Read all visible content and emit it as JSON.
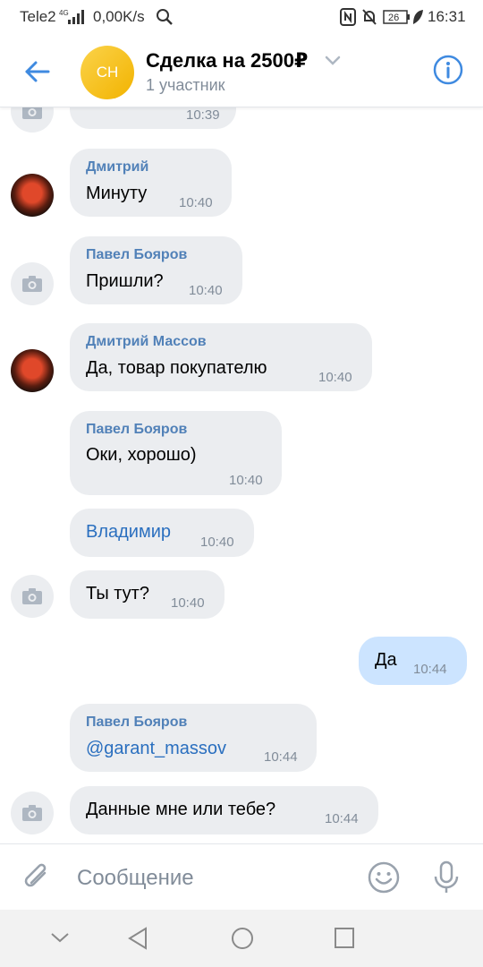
{
  "status_bar": {
    "carrier": "Tele2",
    "network": "4G",
    "speed": "0,00K/s",
    "battery": "26",
    "time": "16:31"
  },
  "header": {
    "avatar_initials": "СН",
    "title": "Сделка на 2500₽",
    "subtitle": "1 участник",
    "avatar_color": "#f5bf1c",
    "accent": "#3f8ae0"
  },
  "messages": [
    {
      "sender": "",
      "text": "",
      "time": "10:39",
      "avatar": "camera-icon",
      "out": false
    },
    {
      "sender": "Дмитрий",
      "text": "Минуту",
      "time": "10:40",
      "avatar": "user-photo",
      "out": false
    },
    {
      "sender": "Павел Бояров",
      "text": "Пришли?",
      "time": "10:40",
      "avatar": "camera-icon",
      "out": false
    },
    {
      "sender": "Дмитрий Массов",
      "text": "Да, товар покупателю",
      "time": "10:40",
      "avatar": "user-photo",
      "out": false
    },
    {
      "sender": "Павел Бояров",
      "text": "Оки, хорошо)",
      "time": "10:40",
      "avatar": "",
      "out": false
    },
    {
      "sender": "",
      "text": "Владимир",
      "time": "10:40",
      "avatar": "",
      "out": false,
      "link": true
    },
    {
      "sender": "",
      "text": "Ты тут?",
      "time": "10:40",
      "avatar": "camera-icon",
      "out": false
    },
    {
      "sender": "",
      "text": "Да",
      "time": "10:44",
      "avatar": "",
      "out": true
    },
    {
      "sender": "Павел Бояров",
      "text": "@garant_massov",
      "time": "10:44",
      "avatar": "",
      "out": false,
      "link": true
    },
    {
      "sender": "",
      "text": "Данные мне или тебе?",
      "time": "10:44",
      "avatar": "camera-icon",
      "out": false
    }
  ],
  "composer": {
    "placeholder": "Сообщение"
  },
  "colors": {
    "incoming_bubble": "#ebedf0",
    "outgoing_bubble": "#cce4ff",
    "sender_name": "#5181b8",
    "link": "#2a6fbf",
    "muted": "#818c99"
  }
}
